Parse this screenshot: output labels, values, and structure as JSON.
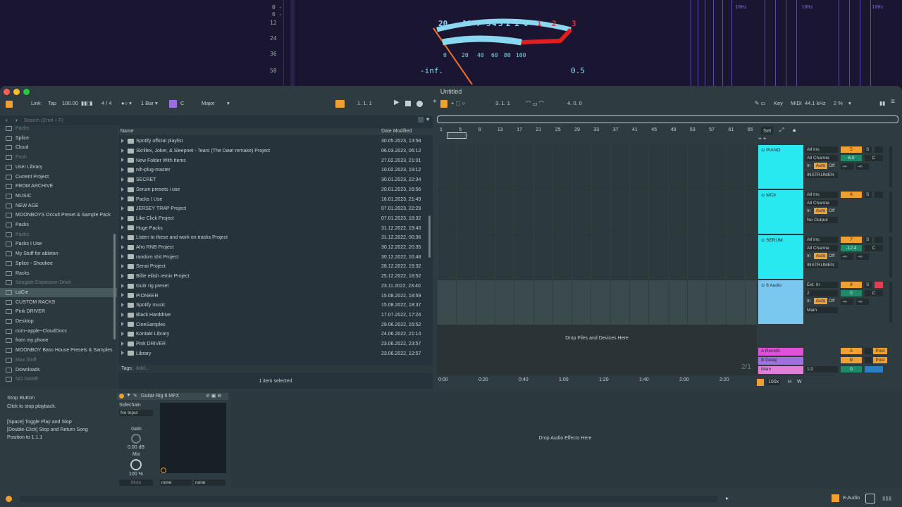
{
  "meters": {
    "db_scale": [
      "0 -",
      "6 -",
      "12",
      "24",
      "36",
      "50"
    ],
    "vu_top_black": [
      "20",
      "10",
      "7",
      "5",
      "4",
      "3",
      "2",
      "1",
      "0"
    ],
    "vu_top_red": [
      "1",
      "2",
      "3"
    ],
    "vu_bottom": [
      "0",
      "20",
      "40",
      "60",
      "80",
      "100"
    ],
    "left_readout": "-inf.",
    "right_readout": "0.5",
    "spectrum_labels": [
      "10Hz",
      "10Hz",
      "10Hz",
      "10Hz"
    ]
  },
  "window": {
    "title": "Untitled"
  },
  "control_bar": {
    "link": "Link",
    "tap": "Tap",
    "tempo": "100.00",
    "signature": "4 / 4",
    "quantize": "1 Bar",
    "key": "C",
    "scale": "Major",
    "position": "1.   1.   1",
    "loop_start": "3.   1.   1",
    "loop_len": "4.   0.   0",
    "key_label": "Key",
    "midi_label": "MIDI",
    "sample_rate": "44.1 kHz",
    "cpu": "2 %"
  },
  "browser": {
    "search_placeholder": "Search (Cmd + F)",
    "col_name": "Name",
    "col_date": "Date Modified",
    "places": [
      {
        "label": "Packs",
        "style": "dim"
      },
      {
        "label": "Splice",
        "style": ""
      },
      {
        "label": "Cloud",
        "style": ""
      },
      {
        "label": "Push",
        "style": "dim"
      },
      {
        "label": "User Library",
        "style": ""
      },
      {
        "label": "Current Project",
        "style": ""
      },
      {
        "label": "FROM ARCHIVE",
        "style": ""
      },
      {
        "label": "MUSIC",
        "style": ""
      },
      {
        "label": "NEW AGE",
        "style": ""
      },
      {
        "label": "MOONBOYS Occult Preset & Sample Pack",
        "style": ""
      },
      {
        "label": "Packs",
        "style": ""
      },
      {
        "label": "Packs",
        "style": "dim"
      },
      {
        "label": "Packs I Use",
        "style": ""
      },
      {
        "label": "My Stuff for ableton",
        "style": ""
      },
      {
        "label": "Splice - Shookee",
        "style": ""
      },
      {
        "label": "Racks",
        "style": ""
      },
      {
        "label": "Seagate Expansion Drive",
        "style": "dim"
      },
      {
        "label": "LaCie",
        "style": "sel"
      },
      {
        "label": "CUSTOM RACKS",
        "style": ""
      },
      {
        "label": "Pink DRIVER",
        "style": ""
      },
      {
        "label": "Desktop",
        "style": ""
      },
      {
        "label": "com~apple~CloudDocs",
        "style": ""
      },
      {
        "label": "from my phone",
        "style": ""
      },
      {
        "label": "MOONBOY Bass House Presets & Samples",
        "style": ""
      },
      {
        "label": "Max Stuff",
        "style": "dim"
      },
      {
        "label": "Downloads",
        "style": ""
      },
      {
        "label": "NO NAME",
        "style": "dim"
      }
    ],
    "files": [
      {
        "name": "Spotify official playlist",
        "date": "30.05.2023, 13:58"
      },
      {
        "name": "Skrillex, Joker, & Sleepnet - Tears (The Døør remake) Project",
        "date": "06.03.2023, 06:12"
      },
      {
        "name": "New Folder With Items",
        "date": "27.02.2023, 21:01"
      },
      {
        "name": "nih-plug-master",
        "date": "10.02.2023, 19:12"
      },
      {
        "name": "SECRET",
        "date": "30.01.2023, 22:34"
      },
      {
        "name": "Serum presets i use",
        "date": "20.01.2023, 16:56"
      },
      {
        "name": "Packs I Use",
        "date": "16.01.2023, 21:49"
      },
      {
        "name": "JERSEY TRAP Project",
        "date": "07.01.2023, 22:29"
      },
      {
        "name": "Like Click Project",
        "date": "07.01.2023, 18:32"
      },
      {
        "name": "Huge Packs",
        "date": "31.12.2022, 19:43"
      },
      {
        "name": "Listen to these and work on tracks Project",
        "date": "31.12.2022, 00:36"
      },
      {
        "name": "Afro RNB Project",
        "date": "30.12.2022, 20:35"
      },
      {
        "name": "random shit Project",
        "date": "30.12.2022, 16:48"
      },
      {
        "name": "Senai Project",
        "date": "28.12.2022, 19:32"
      },
      {
        "name": "Billie eilish remix Project",
        "date": "25.12.2022, 18:52"
      },
      {
        "name": "Guitr rig preset",
        "date": "23.11.2022, 23:40"
      },
      {
        "name": "PIONEER",
        "date": "15.08.2022, 18:59"
      },
      {
        "name": "Spotify music",
        "date": "15.08.2022, 18:37"
      },
      {
        "name": "Black Harddrive",
        "date": "17.07.2022, 17:24"
      },
      {
        "name": "CineSamples",
        "date": "29.06.2022, 16:52"
      },
      {
        "name": "Kontakt Library",
        "date": "24.06.2022, 21:14"
      },
      {
        "name": "Pink DRIVER",
        "date": "23.06.2022, 23:57"
      },
      {
        "name": "Library",
        "date": "23.06.2022, 12:57"
      }
    ],
    "tags_label": "Tags:",
    "tags_placeholder": "Add...",
    "selection_status": "1 item selected"
  },
  "arrangement": {
    "ruler_bars": [
      "1",
      "5",
      "9",
      "13",
      "17",
      "21",
      "25",
      "29",
      "33",
      "37",
      "41",
      "45",
      "49",
      "53",
      "57",
      "61",
      "65"
    ],
    "time_labels": [
      "0:00",
      "0:20",
      "0:40",
      "1:00",
      "1:20",
      "1:40",
      "2:00",
      "2:20"
    ],
    "drop_hint": "Drop Files and Devices Here",
    "set_label": "Set",
    "page_counter": "2/1",
    "zoom": "100x"
  },
  "tracks": [
    {
      "name": "PIANO",
      "input": "All Ins",
      "channel": "All Channe",
      "vol": "5",
      "vol_value": "6.0",
      "pan": "C",
      "output": "INSTRUMEN",
      "color": "#28e8f0"
    },
    {
      "name": "MIDI",
      "input": "All Ins",
      "channel": "All Channe",
      "vol": "6",
      "vol_value": "",
      "pan": "",
      "output": "No Output",
      "color": "#28e8f0"
    },
    {
      "name": "SERUM",
      "input": "All Ins",
      "channel": "All Channe",
      "vol": "7",
      "vol_value": "-12.4",
      "pan": "C",
      "output": "INSTRUMEN",
      "color": "#28e8f0"
    },
    {
      "name": "8 Audio",
      "input": "Ext. In",
      "channel": "2",
      "vol": "8",
      "vol_value": "0",
      "pan": "C",
      "output": "Main",
      "color": "#7ac8f0"
    }
  ],
  "returns": [
    {
      "name": "A Reverb",
      "letter": "A",
      "color": "#e050d8"
    },
    {
      "name": "B Delay",
      "letter": "B",
      "color": "#a070e0"
    },
    {
      "name": "Main",
      "letter": "0",
      "color": "#e080d8"
    }
  ],
  "monitor": {
    "in": "In",
    "auto": "Auto",
    "off": "Off",
    "inf": "-∞",
    "post": "Post",
    "half": "1/2",
    "s": "S",
    "h": "H",
    "w": "W"
  },
  "info_view": {
    "title": "Stop Button",
    "body1": "Click to stop playback.",
    "body2": "[Space] Toggle Play and Stop",
    "body3": "[Double-Click] Stop and Return Song",
    "body4": "Position to 1.1.1"
  },
  "device": {
    "name": "Guitar Rig 6 MFX",
    "sidechain": "Sidechain",
    "sc_input": "No Input",
    "gain_label": "Gain",
    "gain_value": "0.00 dB",
    "mix_label": "Mix",
    "mix_value": "100 %",
    "mute": "Mute",
    "none1": "none",
    "none2": "none"
  },
  "drop_fx": "Drop Audio Effects Here",
  "status": {
    "track": "8-Audio"
  }
}
